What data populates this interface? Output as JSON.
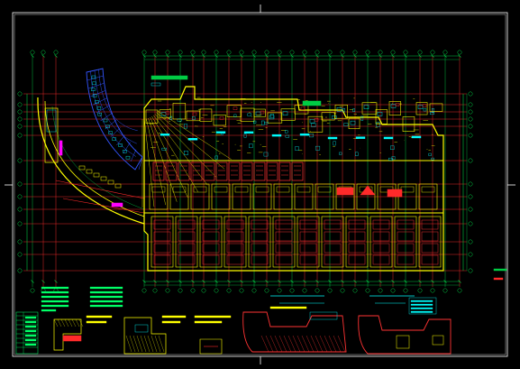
{
  "drawing": {
    "background": "#000000",
    "colors": {
      "frame": "#ffffff",
      "axis": "#00cc44",
      "grid": "#ff2a2a",
      "wall": "#ffff00",
      "fixture": "#00ffff",
      "furniture": "#ff3333",
      "highlight": "#ff00ff",
      "bluegrid": "#3355ff",
      "note": "#00ff66"
    },
    "icons": {
      "tower": "curved-tower-icon",
      "section": "section-detail-icon",
      "legend": "legend-table-icon"
    }
  }
}
